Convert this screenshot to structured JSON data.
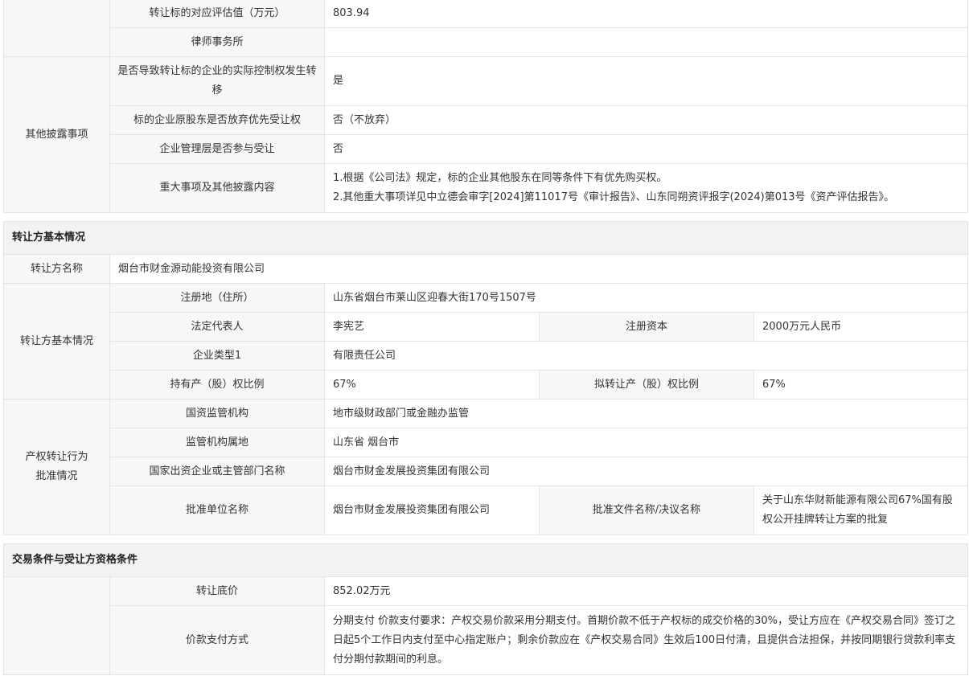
{
  "other_disclosure": {
    "valuation_label": "转让标的对应评估值（万元）",
    "valuation_value": "803.94",
    "law_firm_label": "律师事务所",
    "law_firm_value": "",
    "group_label": "其他披露事项",
    "control_change_label": "是否导致转让标的企业的实际控制权发生转移",
    "control_change_value": "是",
    "preemptive_label": "标的企业原股东是否放弃优先受让权",
    "preemptive_value": "否（不放弃）",
    "mgmt_label": "企业管理层是否参与受让",
    "mgmt_value": "否",
    "major_label": "重大事项及其他披露内容",
    "major_line1": "1.根据《公司法》规定，标的企业其他股东在同等条件下有优先购买权。",
    "major_line2": "2.其他重大事项详见中立德会审字[2024]第11017号《审计报告》、山东同朔资评报字(2024)第013号《资产评估报告》。"
  },
  "transferor": {
    "section_title": "转让方基本情况",
    "name_label": "转让方名称",
    "name_value": "烟台市财金源动能投资有限公司",
    "basic_group_label": "转让方基本情况",
    "address_label": "注册地（住所）",
    "address_value": "山东省烟台市莱山区迎春大街170号1507号",
    "legal_rep_label": "法定代表人",
    "legal_rep_value": "李宪艺",
    "capital_label": "注册资本",
    "capital_value": "2000万元人民币",
    "type_label": "企业类型1",
    "type_value": "有限责任公司",
    "holding_label": "持有产（股）权比例",
    "holding_value": "67%",
    "planned_label": "拟转让产（股）权比例",
    "planned_value": "67%",
    "approval_group_label_1": "产权转让行为",
    "approval_group_label_2": "批准情况",
    "regulator_label": "国资监管机构",
    "regulator_value": "地市级财政部门或金融办监管",
    "regulator_loc_label": "监管机构属地",
    "regulator_loc_value": "山东省 烟台市",
    "invest_dept_label": "国家出资企业或主管部门名称",
    "invest_dept_value": "烟台市财金发展投资集团有限公司",
    "approver_label": "批准单位名称",
    "approver_value": "烟台市财金发展投资集团有限公司",
    "doc_label": "批准文件名称/决议名称",
    "doc_value": "关于山东华财新能源有限公司67%国有股权公开挂牌转让方案的批复"
  },
  "trade_terms": {
    "section_title": "交易条件与受让方资格条件",
    "price_label": "转让底价",
    "price_value": "852.02万元",
    "payment_label": "价款支付方式",
    "payment_value": "分期支付 价款支付要求：产权交易价款采用分期支付。首期价款不低于产权标的成交价格的30%，受让方应在《产权交易合同》签订之日起5个工作日内支付至中心指定账户；剩余价款应在《产权交易合同》生效后100日付清，且提供合法担保，并按同期银行贷款利率支付分期付款期间的利息。"
  }
}
